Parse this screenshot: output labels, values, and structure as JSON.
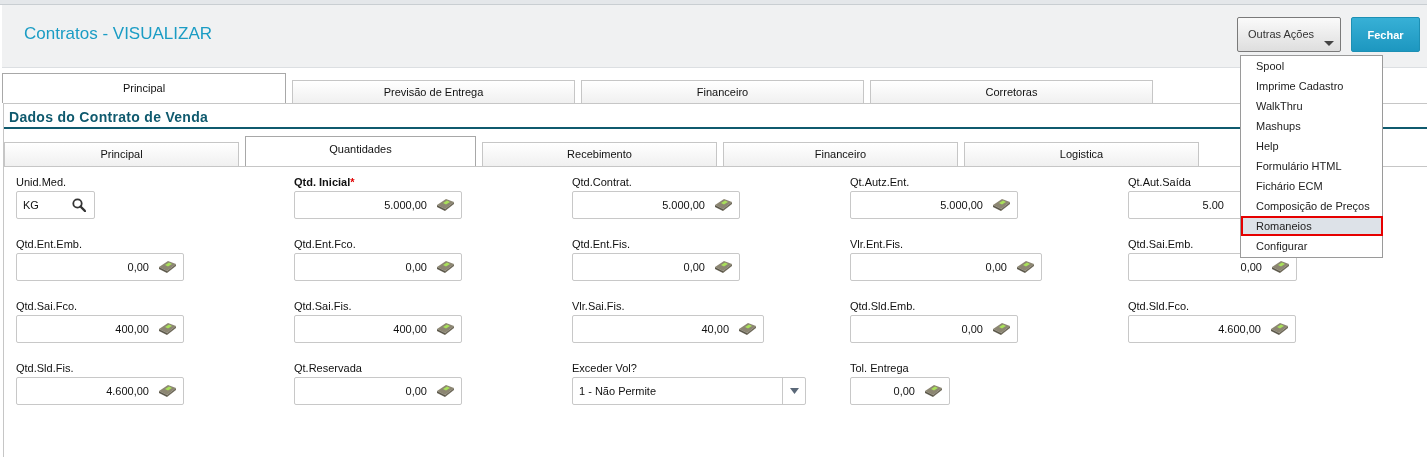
{
  "header": {
    "title": "Contratos - VISUALIZAR",
    "actions": [
      {
        "label": "Outras Ações",
        "kind": "dropdown"
      },
      {
        "label": "Fechar",
        "kind": "primary"
      }
    ]
  },
  "tabs": [
    {
      "label": "Principal",
      "selected": true
    },
    {
      "label": "Previsão de Entrega",
      "selected": false
    },
    {
      "label": "Financeiro",
      "selected": false
    },
    {
      "label": "Corretoras",
      "selected": false
    }
  ],
  "section": {
    "title": "Dados do Contrato de Venda"
  },
  "subtabs": [
    {
      "label": "Principal",
      "selected": false
    },
    {
      "label": "Quantidades",
      "selected": true
    },
    {
      "label": "Recebimento",
      "selected": false
    },
    {
      "label": "Financeiro",
      "selected": false
    },
    {
      "label": "Logistica",
      "selected": false
    }
  ],
  "fields": [
    {
      "label": "Unid.Med.",
      "value": "KG",
      "kind": "lookup"
    },
    {
      "label": "Qtd. Inicial",
      "required": true,
      "required_mark": "*",
      "value": "5.000,00",
      "kind": "number"
    },
    {
      "label": "Qtd.Contrat.",
      "value": "5.000,00",
      "kind": "number"
    },
    {
      "label": "Qt.Autz.Ent.",
      "value": "5.000,00",
      "kind": "number"
    },
    {
      "label": "Qt.Aut.Saída",
      "value": "5.00",
      "kind": "number",
      "covered": true
    },
    {
      "label": "Qtd.Ent.Emb.",
      "value": "0,00",
      "kind": "number"
    },
    {
      "label": "Qtd.Ent.Fco.",
      "value": "0,00",
      "kind": "number"
    },
    {
      "label": "Qtd.Ent.Fis.",
      "value": "0,00",
      "kind": "number"
    },
    {
      "label": "Vlr.Ent.Fis.",
      "value": "0,00",
      "kind": "number"
    },
    {
      "label": "Qtd.Sai.Emb.",
      "value": "0,00",
      "kind": "number"
    },
    {
      "label": "Qtd.Sai.Fco.",
      "value": "400,00",
      "kind": "number"
    },
    {
      "label": "Qtd.Sai.Fis.",
      "value": "400,00",
      "kind": "number"
    },
    {
      "label": "Vlr.Sai.Fis.",
      "value": "40,00",
      "kind": "number"
    },
    {
      "label": "Qtd.Sld.Emb.",
      "value": "0,00",
      "kind": "number"
    },
    {
      "label": "Qtd.Sld.Fco.",
      "value": "4.600,00",
      "kind": "number"
    },
    {
      "label": "Qtd.Sld.Fis.",
      "value": "4.600,00",
      "kind": "number"
    },
    {
      "label": "Qt.Reservada",
      "value": "0,00",
      "kind": "number"
    },
    {
      "label": "Exceder Vol?",
      "value": "1 - Não Permite",
      "kind": "select"
    },
    {
      "label": "Tol. Entrega",
      "value": "0,00",
      "kind": "number"
    }
  ],
  "menu": {
    "items": [
      {
        "label": "Spool",
        "selected": false
      },
      {
        "label": "Imprime Cadastro",
        "selected": false
      },
      {
        "label": "WalkThru",
        "selected": false
      },
      {
        "label": "Mashups",
        "selected": false
      },
      {
        "label": "Help",
        "selected": false
      },
      {
        "label": "Formulário HTML",
        "selected": false
      },
      {
        "label": "Fichário ECM",
        "selected": false
      },
      {
        "label": "Composição de Preços",
        "selected": false
      },
      {
        "label": "Romaneios",
        "selected": true
      },
      {
        "label": "Configurar",
        "selected": false
      }
    ]
  }
}
